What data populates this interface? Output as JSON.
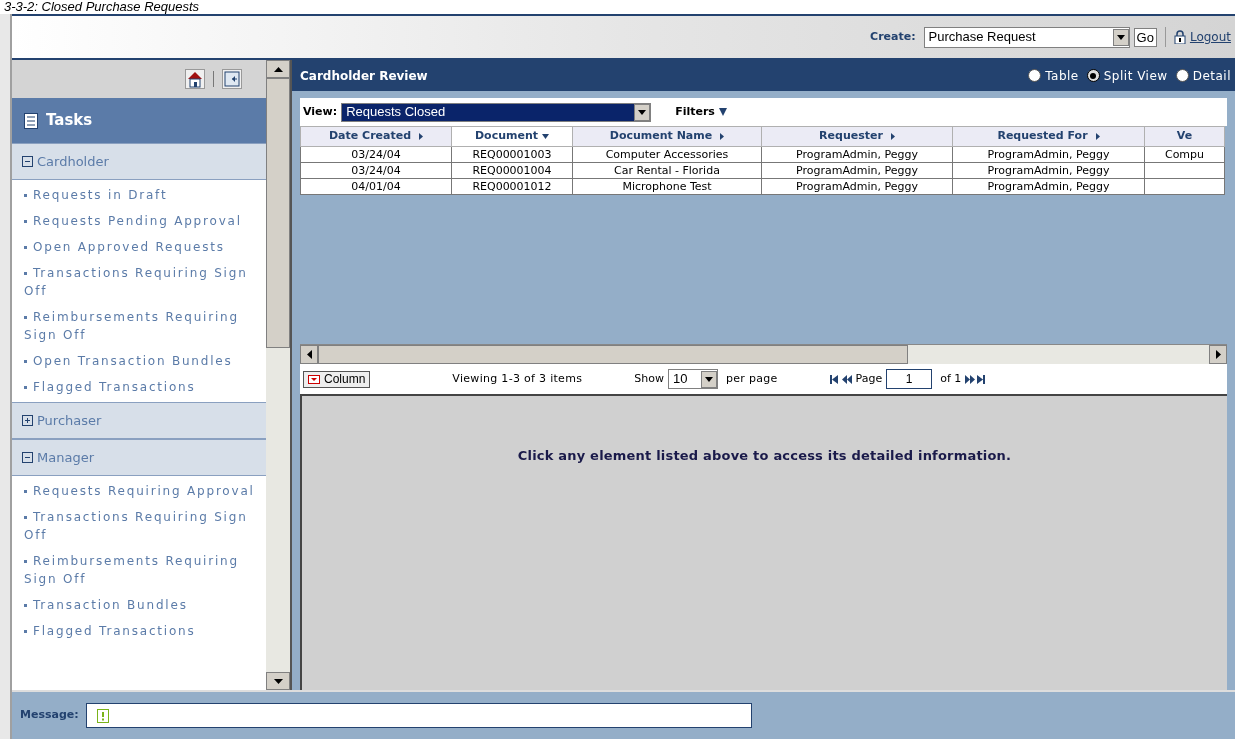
{
  "caption": "3-3-2: Closed Purchase Requests",
  "header": {
    "create_label": "Create:",
    "create_value": "Purchase Request",
    "go": "Go",
    "logout": "Logout"
  },
  "sidebar": {
    "title": "Tasks",
    "sections": [
      {
        "label": "Cardholder",
        "expanded": true,
        "items": [
          "Requests in Draft",
          "Requests Pending Approval",
          "Open Approved Requests",
          "Transactions Requiring Sign Off",
          "Reimbursements Requiring Sign Off",
          "Open Transaction Bundles",
          "Flagged Transactions"
        ]
      },
      {
        "label": "Purchaser",
        "expanded": false
      },
      {
        "label": "Manager",
        "expanded": true,
        "items": [
          "Requests Requiring Approval",
          "Transactions Requiring Sign Off",
          "Reimbursements Requiring Sign Off",
          "Transaction Bundles",
          "Flagged Transactions"
        ]
      }
    ]
  },
  "main": {
    "title": "Cardholder Review",
    "view_modes": [
      {
        "label": "Table",
        "selected": false
      },
      {
        "label": "Split View",
        "selected": true
      },
      {
        "label": "Detail",
        "selected": false
      }
    ],
    "view_label": "View:",
    "view_value": "Requests Closed",
    "filters": "Filters",
    "table": {
      "columns": [
        {
          "label": "Date Created",
          "sorted": false,
          "arrow": true
        },
        {
          "label": "Document",
          "sorted": true,
          "arrow": true
        },
        {
          "label": "Document Name",
          "sorted": false,
          "arrow": true
        },
        {
          "label": "Requester",
          "sorted": false,
          "arrow": true
        },
        {
          "label": "Requested For",
          "sorted": false,
          "arrow": true
        },
        {
          "label": "Ve",
          "sorted": false,
          "arrow": false
        }
      ],
      "rows": [
        {
          "cells": [
            "03/24/04",
            "REQ00001003",
            "Computer Accessories",
            "ProgramAdmin, Peggy",
            "ProgramAdmin, Peggy",
            "Compu"
          ]
        },
        {
          "cells": [
            "03/24/04",
            "REQ00001004",
            "Car Rental - Florida",
            "ProgramAdmin, Peggy",
            "ProgramAdmin, Peggy"
          ]
        },
        {
          "cells": [
            "04/01/04",
            "REQ00001012",
            "Microphone Test",
            "ProgramAdmin, Peggy",
            "ProgramAdmin, Peggy"
          ]
        }
      ]
    },
    "pager": {
      "column_button": "Column",
      "viewing": "Viewing 1-3 of 3 items",
      "show": "Show",
      "per_page_value": "10",
      "per_page": "per page",
      "page_label": "Page",
      "page_value": "1",
      "of": "of 1"
    },
    "detail_message": "Click any element listed above to access its detailed information."
  },
  "message_bar": {
    "label": "Message:"
  }
}
